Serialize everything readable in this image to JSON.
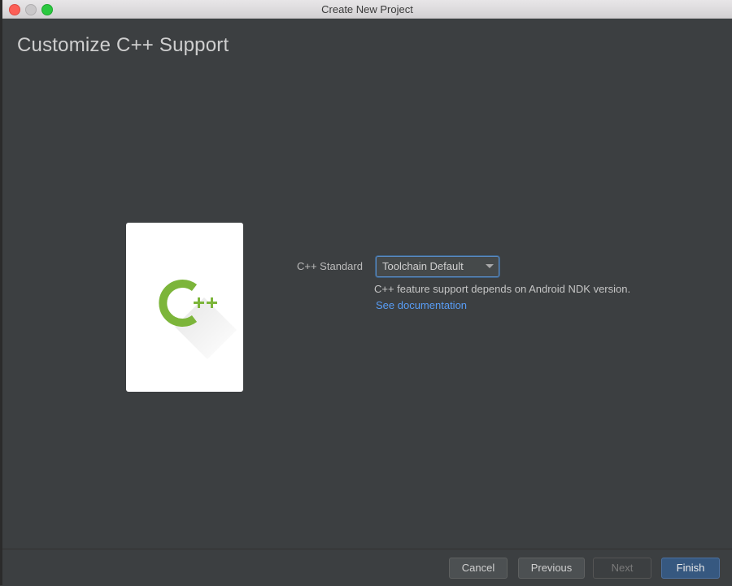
{
  "window": {
    "title": "Create New Project"
  },
  "page": {
    "title": "Customize C++ Support"
  },
  "illustration": {
    "icon": "cpp-logo-icon",
    "logo_text": "C++",
    "accent_color": "#7cb53a"
  },
  "form": {
    "cpp_standard_label": "C++ Standard",
    "cpp_standard_value": "Toolchain Default",
    "hint_text": "C++ feature support depends on Android NDK version.",
    "doc_link": "See documentation"
  },
  "footer": {
    "cancel_label": "Cancel",
    "previous_label": "Previous",
    "next_label": "Next",
    "finish_label": "Finish"
  },
  "colors": {
    "background": "#3c3f41",
    "link": "#589df6",
    "primary_button": "#365880"
  }
}
